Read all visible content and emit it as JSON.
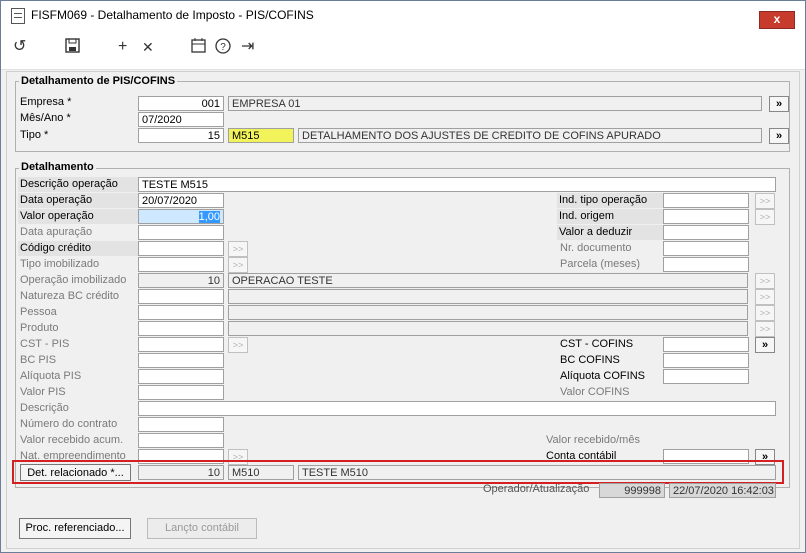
{
  "window": {
    "title": "FISFM069 - Detalhamento de Imposto - PIS/COFINS",
    "close": "x"
  },
  "toolbar": {
    "undo": "↺",
    "save": "💾",
    "add": "+",
    "remove": "✕",
    "calendar": "📅",
    "help": "?",
    "exit": "⇥"
  },
  "sec1": {
    "title": "Detalhamento de PIS/COFINS",
    "empresa_label": "Empresa *",
    "empresa_code": "001",
    "empresa_name": "EMPRESA 01",
    "mesano_label": "Mês/Ano *",
    "mesano_value": "07/2020",
    "tipo_label": "Tipo *",
    "tipo_num": "15",
    "tipo_code": "M515",
    "tipo_desc": "DETALHAMENTO DOS AJUSTES DE CREDITO DE COFINS APURADO",
    "lookup": "»"
  },
  "sec2": {
    "title": "Detalhamento",
    "desc_op_label": "Descrição operação",
    "desc_op_value": "TESTE  M515",
    "data_op_label": "Data operação",
    "data_op_value": "20/07/2020",
    "valor_op_label": "Valor operação",
    "valor_op_value": "1,00",
    "data_apur_label": "Data apuração",
    "cod_cred_label": "Código crédito",
    "tipo_imob_label": "Tipo imobilizado",
    "op_imob_label": "Operação imobilizado",
    "op_imob_num": "10",
    "op_imob_desc": "OPERACAO TESTE",
    "nat_bc_label": "Natureza BC crédito",
    "pessoa_label": "Pessoa",
    "produto_label": "Produto",
    "cst_pis_label": "CST - PIS",
    "bc_pis_label": "BC PIS",
    "aliq_pis_label": "Alíquota PIS",
    "valor_pis_label": "Valor PIS",
    "descricao_label": "Descrição",
    "num_contrato_label": "Número do contrato",
    "valor_receb_acum_label": "Valor recebido acum.",
    "nat_empreend_label": "Nat. empreendimento",
    "ind_tipo_op_label": "Ind. tipo operação",
    "ind_origem_label": "Ind. origem",
    "valor_deduzir_label": "Valor a deduzir",
    "nr_doc_label": "Nr. documento",
    "parcela_label": "Parcela (meses)",
    "cst_cofins_label": "CST - COFINS",
    "bc_cofins_label": "BC COFINS",
    "aliq_cofins_label": "Alíquota COFINS",
    "valor_cofins_label": "Valor COFINS",
    "valor_receb_mes_label": "Valor recebido/mês",
    "conta_contabil_label": "Conta contábil",
    "det_rel_button": "Det. relacionado *...",
    "det_rel_num": "10",
    "det_rel_code": "M510",
    "det_rel_desc": "TESTE M510",
    "operador_label": "Operador/Atualização",
    "operador_value": "999998",
    "atualizacao_value": "22/07/2020 16:42:03"
  },
  "bottom": {
    "proc_ref": "Proc. referenciado...",
    "lancto": "Lançto contábil"
  }
}
